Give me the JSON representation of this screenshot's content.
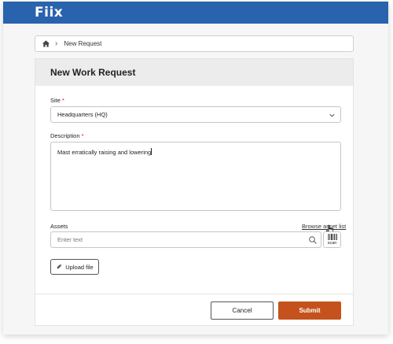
{
  "app": {
    "logo_text": "Fiix",
    "brand_color": "#2a63ad"
  },
  "breadcrumb": {
    "home_icon": "home-icon",
    "current": "New Request"
  },
  "form": {
    "title": "New Work Request",
    "site": {
      "label": "Site",
      "required_mark": "*",
      "value": "Headquarters (HQ)"
    },
    "description": {
      "label": "Description",
      "required_mark": "*",
      "value": "Mast erratically raising and lowering"
    },
    "assets": {
      "label": "Assets",
      "browse_link": "Browse asset list",
      "placeholder": "Enter text",
      "scan_label": "scan"
    },
    "upload_label": "Upload file",
    "cancel_label": "Cancel",
    "submit_label": "Submit",
    "submit_color": "#c5521c"
  }
}
